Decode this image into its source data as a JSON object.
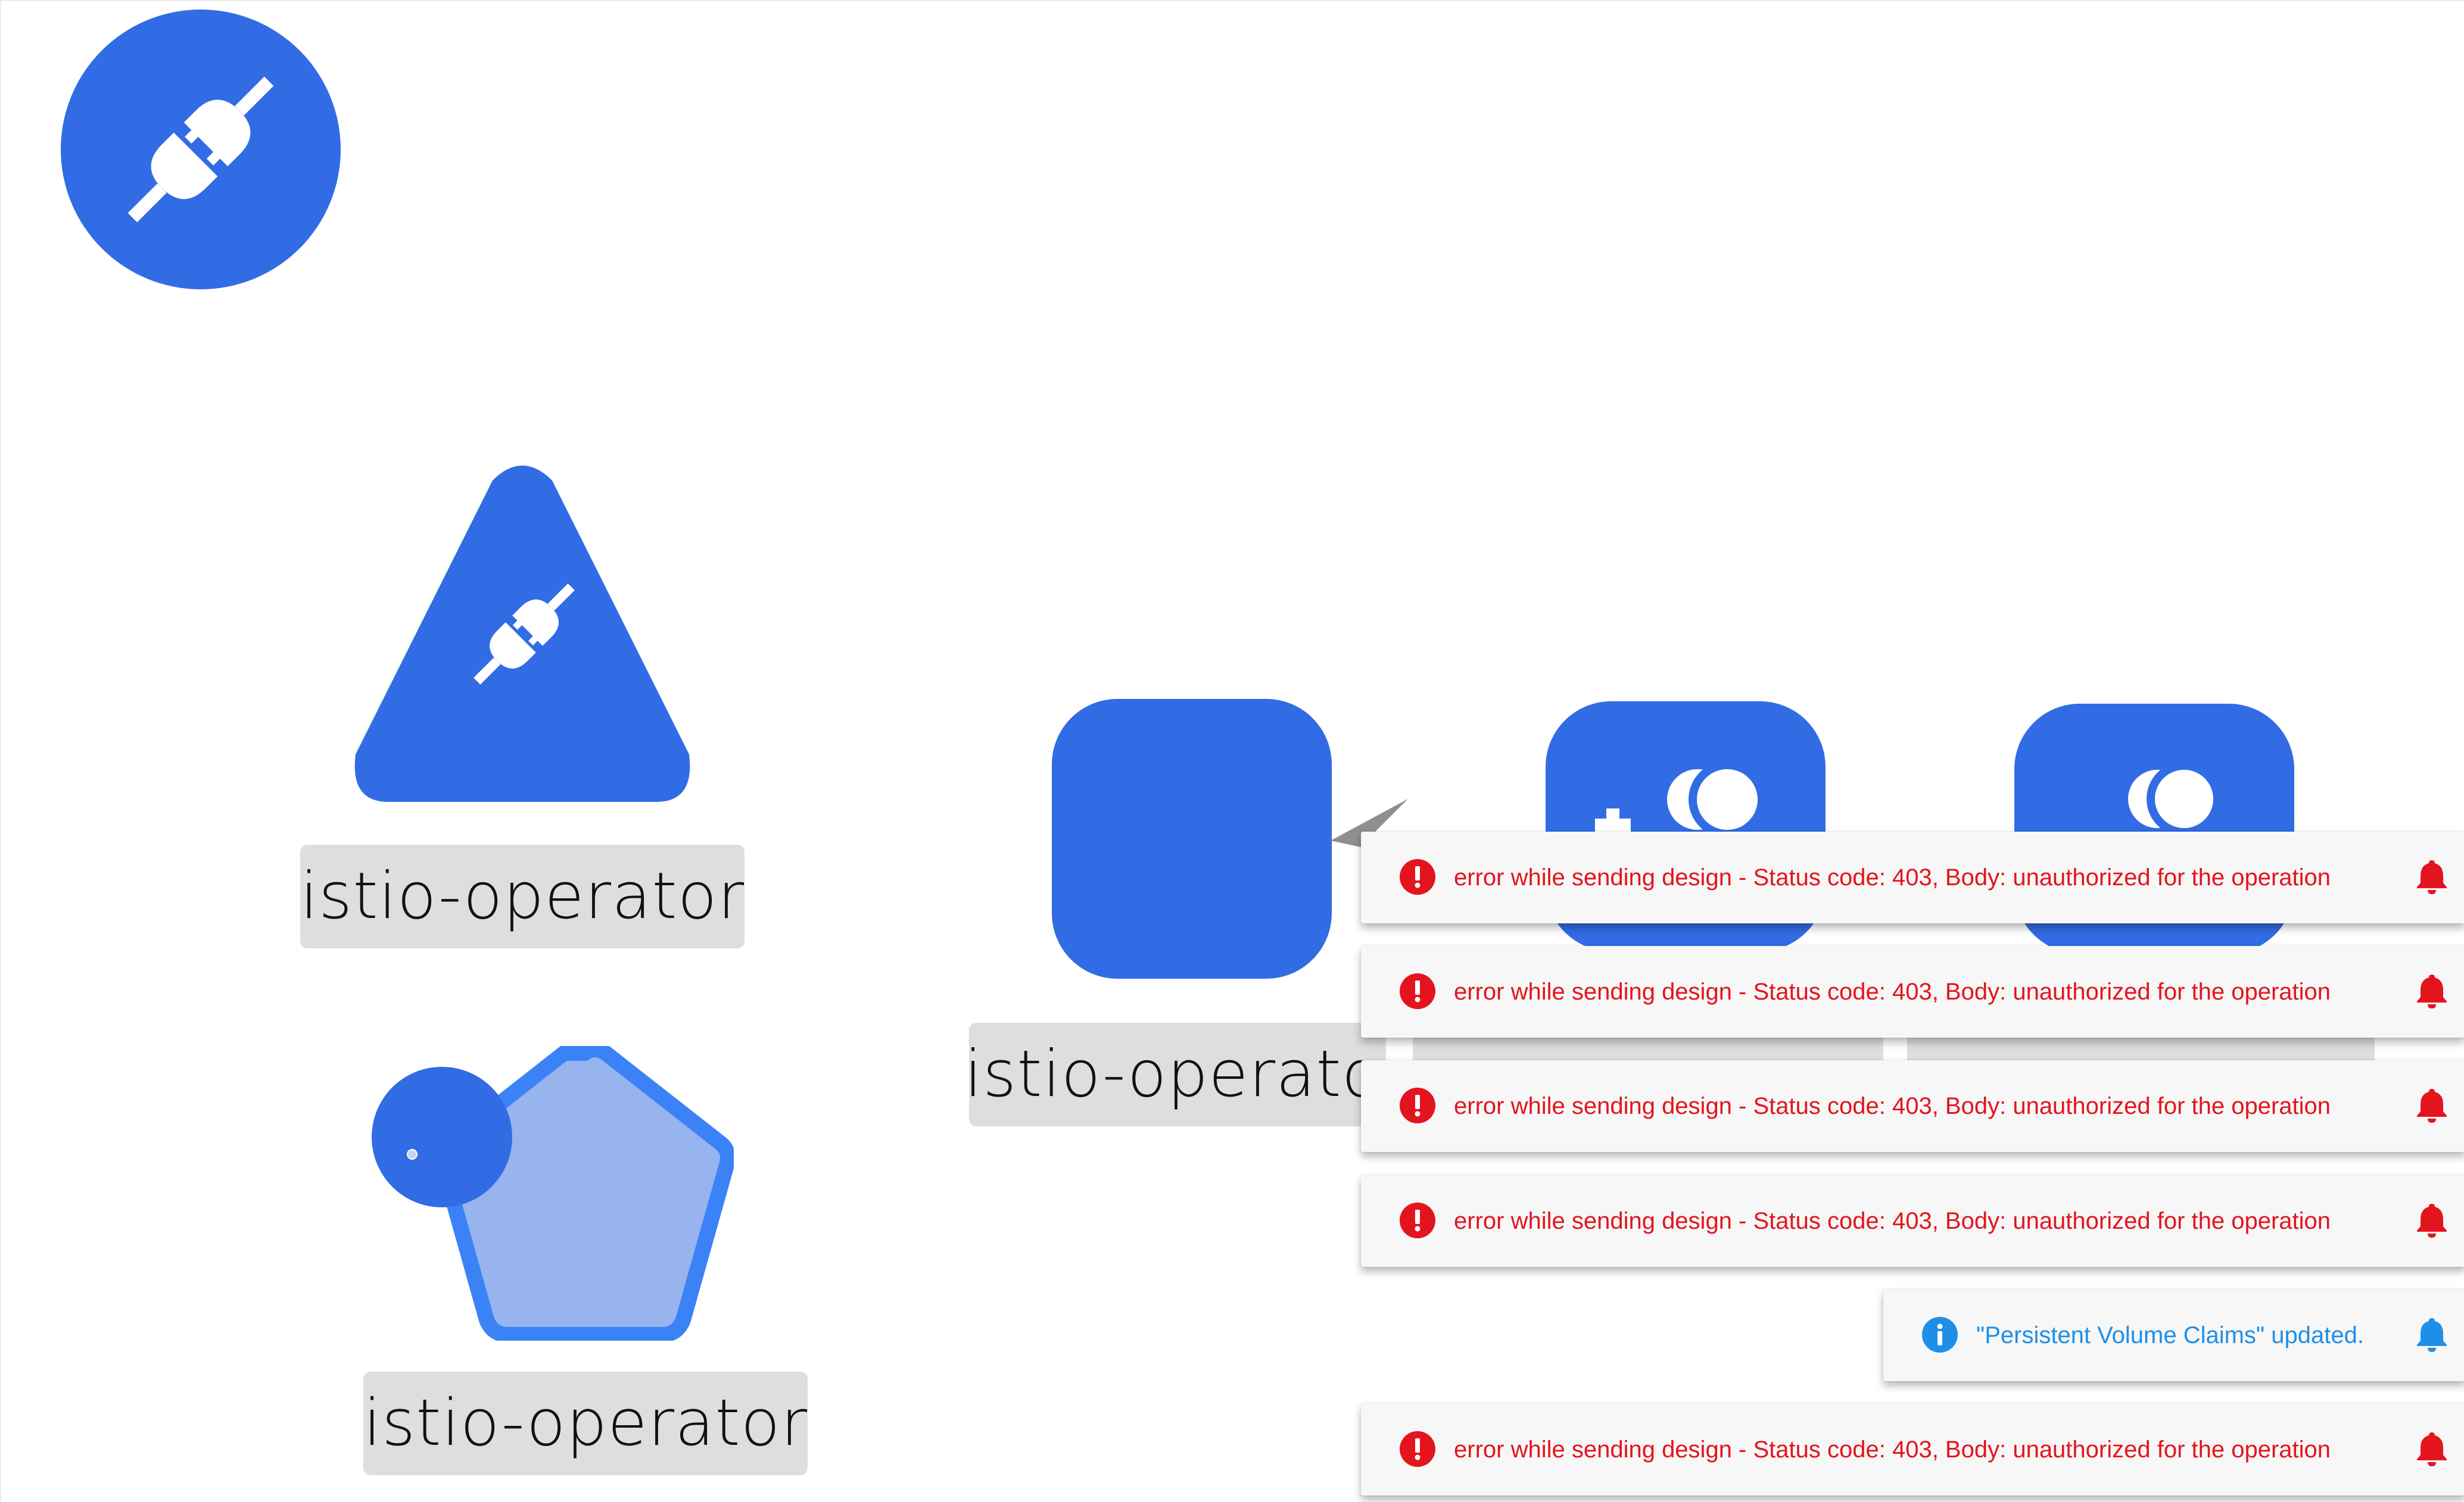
{
  "colors": {
    "node_blue": "#326ce5",
    "node_light_blue": "#97b4ef",
    "node_outline_blue": "#3b82f6",
    "label_bg": "#dededc",
    "toast_bg": "#f6f7f6",
    "error_red": "#e3141e",
    "info_blue": "#1e8fe8"
  },
  "canvas": {
    "nodes": [
      {
        "id": "circle-node",
        "shape": "circle",
        "icon": "plug-icon"
      },
      {
        "id": "triangle-node",
        "shape": "triangle",
        "icon": "plug-icon",
        "label": "istio-operator"
      },
      {
        "id": "pentagon-node",
        "shape": "pentagon",
        "label": "istio-operator"
      },
      {
        "id": "square-node",
        "shape": "rounded-square",
        "label": "istio-operato"
      },
      {
        "id": "square-node-2",
        "shape": "rounded-square",
        "icon": "toggle-icon"
      },
      {
        "id": "square-node-3",
        "shape": "rounded-square",
        "icon": "toggle-icon"
      }
    ]
  },
  "notifications": [
    {
      "type": "error",
      "icon": "error-circle-icon",
      "message": "error while sending design - Status code: 403, Body: unauthorized for the operation",
      "action_icon": "bell-icon"
    },
    {
      "type": "error",
      "icon": "error-circle-icon",
      "message": "error while sending design - Status code: 403, Body: unauthorized for the operation",
      "action_icon": "bell-icon"
    },
    {
      "type": "error",
      "icon": "error-circle-icon",
      "message": "error while sending design - Status code: 403, Body: unauthorized for the operation",
      "action_icon": "bell-icon"
    },
    {
      "type": "error",
      "icon": "error-circle-icon",
      "message": "error while sending design - Status code: 403, Body: unauthorized for the operation",
      "action_icon": "bell-icon"
    },
    {
      "type": "info",
      "icon": "info-circle-icon",
      "message": "\"Persistent Volume Claims\" updated.",
      "action_icon": "bell-icon"
    },
    {
      "type": "error",
      "icon": "error-circle-icon",
      "message": "error while sending design - Status code: 403, Body: unauthorized for the operation",
      "action_icon": "bell-icon"
    }
  ]
}
